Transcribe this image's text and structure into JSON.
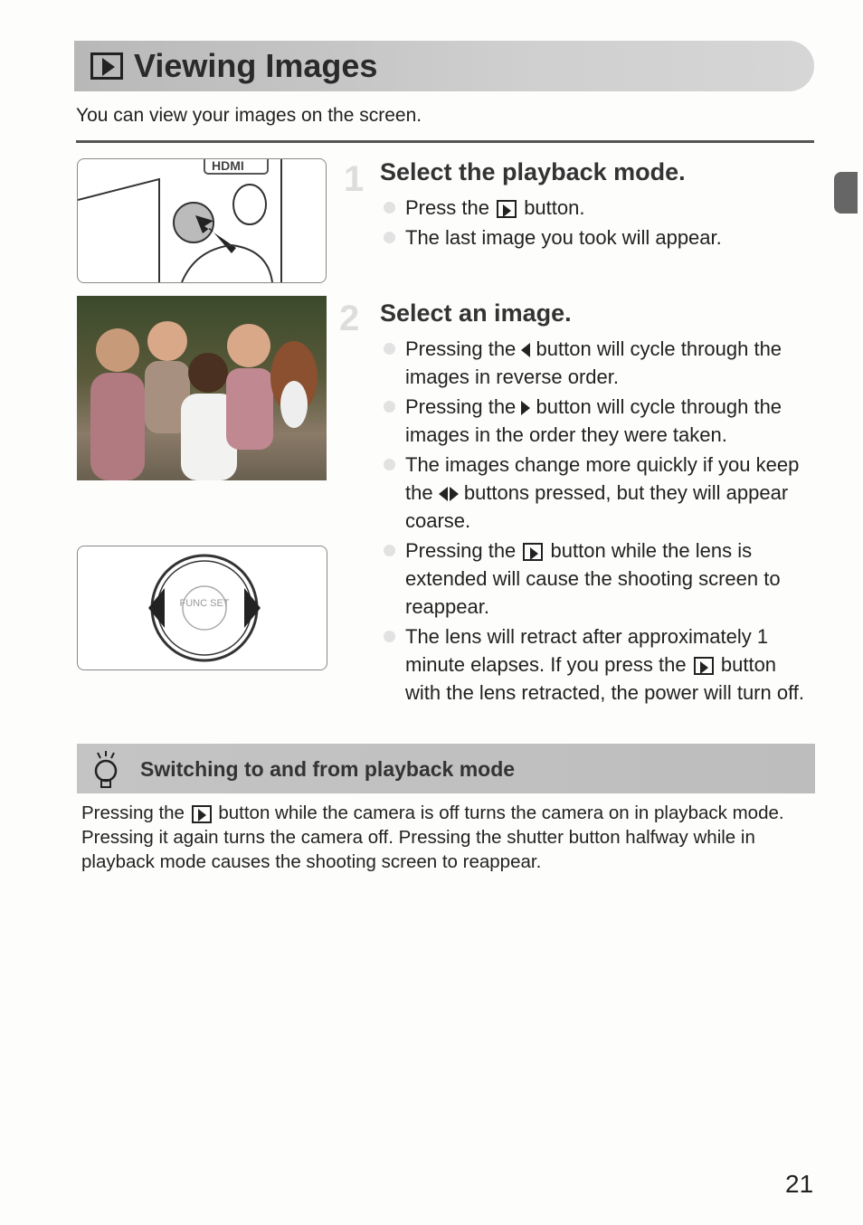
{
  "header": {
    "title": "Viewing Images",
    "title_icon": "playback-icon"
  },
  "intro": "You can view your images on the screen.",
  "steps": [
    {
      "number": "1",
      "heading": "Select the playback mode.",
      "bullets": [
        {
          "before": "Press the",
          "icon": "playback-icon",
          "after": "button."
        },
        {
          "before": "The last image you took will appear."
        }
      ]
    },
    {
      "number": "2",
      "heading": "Select an image.",
      "bullets": [
        {
          "before": "Pressing the",
          "icon": "left-arrow-icon",
          "after": "button will cycle through the images in reverse order."
        },
        {
          "before": "Pressing the",
          "icon": "right-arrow-icon",
          "after": "button will cycle through the images in the order they were taken."
        },
        {
          "before": "The images change more quickly if you keep the",
          "icon": "left-right-arrows-icon",
          "after": "buttons pressed, but they will appear coarse."
        },
        {
          "before": "Pressing the",
          "icon": "playback-icon",
          "after": "button while the lens is extended will cause the shooting screen to reappear."
        },
        {
          "before": "The lens will retract after approximately 1 minute elapses. If you press the",
          "icon": "playback-icon",
          "after": "button with the lens retracted, the power will turn off."
        }
      ]
    }
  ],
  "illustrations": {
    "camera_label": "HDMI",
    "dial_center": "FUNC SET"
  },
  "tip": {
    "title": "Switching to and from playback mode",
    "icon": "lightbulb-icon",
    "before": "Pressing the",
    "after": "button while the camera is off turns the camera on in playback mode. Pressing it again turns the camera off. Pressing the shutter button halfway while in playback mode causes the shooting screen to reappear."
  },
  "page_number": "21"
}
